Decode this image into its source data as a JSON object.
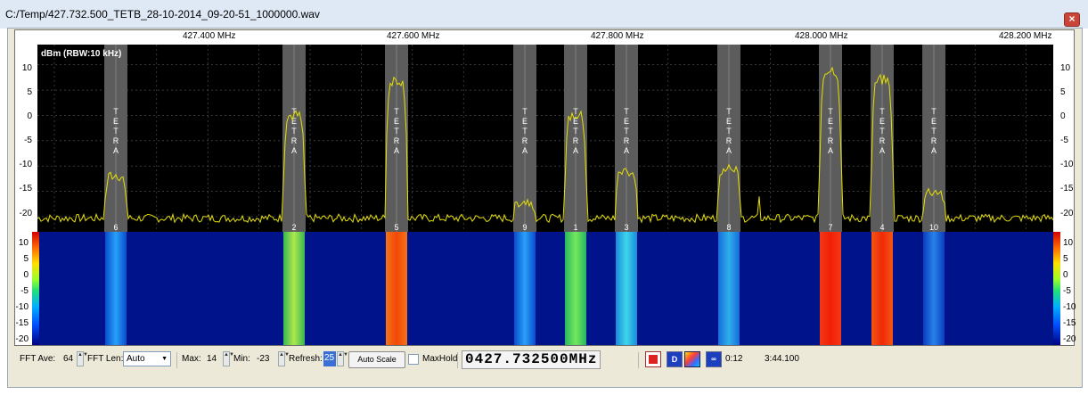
{
  "window": {
    "title": "C:/Temp/427.732.500_TETB_28-10-2014_09-20-51_1000000.wav",
    "close_glyph": "×"
  },
  "freq_axis": [
    "427.400 MHz",
    "427.600 MHz",
    "427.800 MHz",
    "428.000 MHz",
    "428.200 MHz"
  ],
  "spectrum": {
    "unit_label": "dBm (RBW:10 kHz)",
    "y_ticks": [
      "10",
      "5",
      "0",
      "-5",
      "-10",
      "-15",
      "-20"
    ],
    "ylim": [
      -23,
      14
    ],
    "channel_tag": "TETRA",
    "channels": [
      {
        "number": "6",
        "level": -12
      },
      {
        "number": "2",
        "level": 0
      },
      {
        "number": "5",
        "level": 7
      },
      {
        "number": "9",
        "level": -17
      },
      {
        "number": "1",
        "level": 0
      },
      {
        "number": "3",
        "level": -11
      },
      {
        "number": "8",
        "level": -10
      },
      {
        "number": "7",
        "level": 9
      },
      {
        "number": "4",
        "level": 7
      },
      {
        "number": "10",
        "level": -15
      }
    ],
    "trace_color": "#e6e000"
  },
  "waterfall": {
    "y_ticks": [
      "10",
      "5",
      "0",
      "-5",
      "-10",
      "-15",
      "-20"
    ]
  },
  "toolbar": {
    "fft_ave_label": "FFT Ave:",
    "fft_ave_value": "64",
    "fft_len_label": "FFT Len:",
    "fft_len_value": "Auto",
    "max_label": "Max:",
    "max_value": "14",
    "min_label": "Min:",
    "min_value": "-23",
    "refresh_label": "Refresh:",
    "refresh_value": "25",
    "auto_scale_label": "Auto Scale",
    "maxhold_label": "MaxHold",
    "frequency_display": "0427.732500MHz",
    "d_button_label": "D",
    "elapsed": "0:12",
    "total": "3:44.100"
  }
}
